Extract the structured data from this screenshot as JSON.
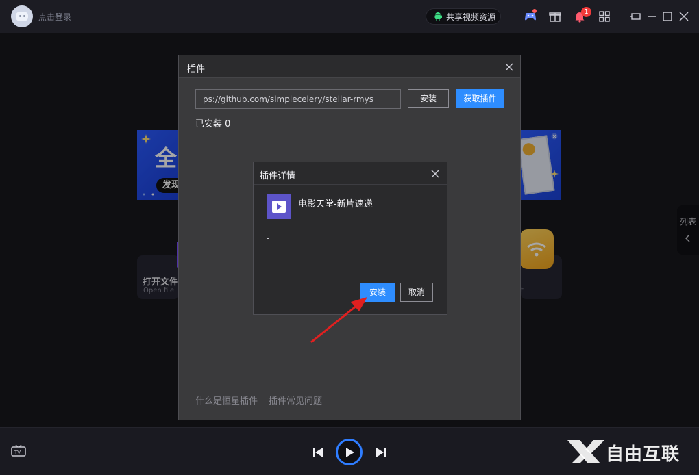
{
  "titlebar": {
    "login_label": "点击登录",
    "share_label": "共享视频资源",
    "notification_count": "1"
  },
  "background": {
    "banner_left_big": "全",
    "banner_left_discover": "发现",
    "card_left_title": "打开文件",
    "card_left_sub": "Open file",
    "card_right_sub": "t",
    "side_tab_label": "列表"
  },
  "plugin_dialog": {
    "title": "插件",
    "url_value": "ps://github.com/simplecelery/stellar-rmys",
    "install_button": "安装",
    "get_plugin_button": "获取插件",
    "installed_label": "已安装 0",
    "footer_links": [
      "什么是恒星插件",
      "插件常见问题"
    ]
  },
  "details_dialog": {
    "title": "插件详情",
    "plugin_name": "电影天堂-新片速递",
    "plugin_description": "-",
    "install_button": "安装",
    "cancel_button": "取消"
  },
  "watermark": {
    "text": "自由互联"
  },
  "colors": {
    "accent_blue": "#2e8dff",
    "notification_red": "#f23b3b",
    "plugin_icon_purple": "#5d54c9",
    "annotation_arrow": "#e02020"
  }
}
